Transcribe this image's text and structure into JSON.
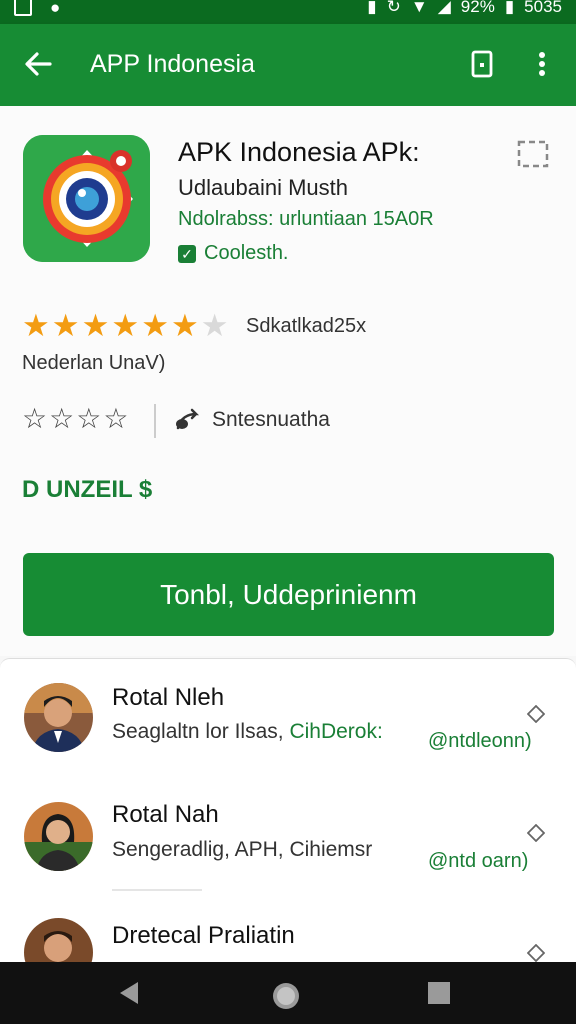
{
  "status_bar": {
    "battery": "92%",
    "time": "5035",
    "left_icons": [
      "image-icon",
      "notification-icon"
    ],
    "right_icons": [
      "vibrate-icon",
      "sync-icon",
      "wifi-icon",
      "signal-icon",
      "battery-icon"
    ]
  },
  "app_bar": {
    "title": "APP Indonesia",
    "back_icon": "arrow-left-icon",
    "actions": [
      "device-icon",
      "more-vert-icon"
    ]
  },
  "app": {
    "name": "APK Indonesia APk:",
    "developer": "Udlaubaini Musth",
    "meta": "Ndolrabss: urluntiaan 15A0R",
    "badge": "Coolesth.",
    "icon": "camera-lens-icon",
    "accent": "#178c34"
  },
  "rating": {
    "stars_filled": 6,
    "stars_total": 7,
    "count_text": "Sdkatlkad25x",
    "category": "Nederlan UnaV)"
  },
  "share": {
    "label": "Sntesnuatha",
    "outline_stars": 4
  },
  "price": "D UNZEIL $",
  "install_button": "Tonbl, Uddeprinienm",
  "reviews": [
    {
      "name": "Rotal Nleh",
      "text": "Seaglaltn lor Ilsas,",
      "handle_inline": "CihDerok:",
      "handle": "@ntdleonn)"
    },
    {
      "name": "Rotal Nah",
      "text": "Sengeradlig, APH, Cihiemsr",
      "handle": "@ntd oarn)"
    },
    {
      "name": "Dretecal Praliatin",
      "text": "",
      "handle": ""
    }
  ],
  "nav": [
    "back-triangle-icon",
    "home-circle-icon",
    "recents-square-icon"
  ]
}
